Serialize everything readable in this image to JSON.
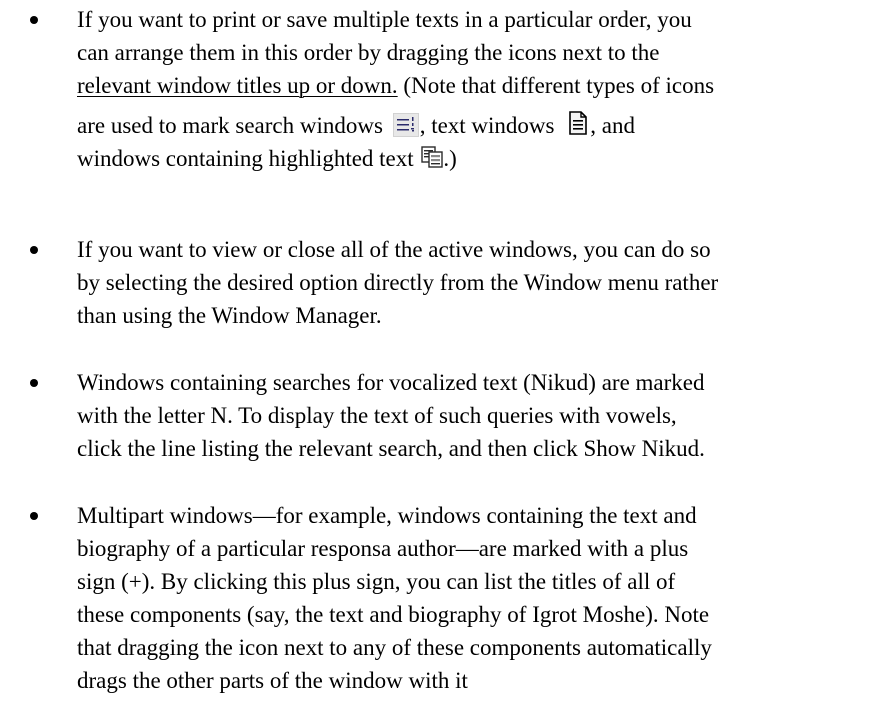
{
  "bullets": [
    {
      "lines": [
        "If you want to print or save multiple texts in a particular order, you",
        "can arrange them in this order by dragging the icons next to the",
        "relevant window titles up or down.",
        " (Note that different types of icons"
      ],
      "line4": {
        "before_search": "are used to mark search windows ",
        "after_search": ", text windows ",
        "after_text": ", and"
      },
      "line5": {
        "before_hl": "windows containing highlighted text ",
        "after_hl": ".)"
      }
    },
    {
      "lines": [
        "If you want to view or close all of the active windows, you can do so",
        "by selecting the desired option directly from the Window menu rather",
        "than using the Window Manager."
      ]
    },
    {
      "lines": [
        "Windows containing searches for vocalized text (Nikud) are marked",
        "with the letter N. To display the text of such queries with vowels,",
        "click the line listing the relevant search, and then click Show Nikud."
      ]
    },
    {
      "lines": [
        "Multipart windows—for example, windows containing the text and",
        "biography of a particular responsa author—are marked with a plus",
        "sign (+). By clicking this plus sign, you can list the titles of all of",
        "these components (say, the text and biography of Igrot Moshe). Note",
        "that dragging the icon next to any of these components automatically",
        "drags the other parts of the window with it"
      ]
    }
  ],
  "icons": {
    "search_window": "search-window-icon",
    "text_window": "text-window-icon",
    "highlighted_text_window": "highlighted-text-window-icon"
  }
}
